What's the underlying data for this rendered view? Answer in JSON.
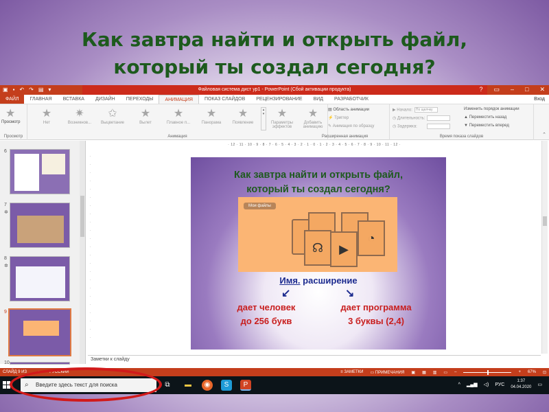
{
  "outer_title": {
    "line1": "Как завтра найти и открыть файл,",
    "line2": "который ты создал сегодня?"
  },
  "window": {
    "title": "Файловая система дист ур1 - PowerPoint (Сбой активации продукта)",
    "help": "?",
    "login": "Вход"
  },
  "tabs": [
    {
      "label": "ФАЙЛ"
    },
    {
      "label": "ГЛАВНАЯ"
    },
    {
      "label": "ВСТАВКА"
    },
    {
      "label": "ДИЗАЙН"
    },
    {
      "label": "ПЕРЕХОДЫ"
    },
    {
      "label": "АНИМАЦИЯ"
    },
    {
      "label": "ПОКАЗ СЛАЙДОВ"
    },
    {
      "label": "РЕЦЕНЗИРОВАНИЕ"
    },
    {
      "label": "ВИД"
    },
    {
      "label": "РАЗРАБОТЧИК"
    }
  ],
  "ribbon": {
    "preview": {
      "button": "Просмотр",
      "group": "Просмотр"
    },
    "animation": {
      "group": "Анимация",
      "effects": [
        "Нет",
        "Возникнов...",
        "Выцветание",
        "Вылет",
        "Плавное п...",
        "Панорама",
        "Появление"
      ],
      "options_button": "Параметры эффектов"
    },
    "advanced": {
      "group": "Расширенная анимация",
      "add_button": "Добавить анимацию",
      "pane": "Область анимации",
      "trigger": "Триггер",
      "painter": "Анимация по образцу"
    },
    "timing": {
      "group": "Время показа слайдов",
      "start_label": "Начало:",
      "start_value": "По щелчку",
      "duration_label": "Длительность:",
      "delay_label": "Задержка:",
      "reorder": "Изменить порядок анимации",
      "move_earlier": "Переместить назад",
      "move_later": "Переместить вперед"
    }
  },
  "thumbnails": [
    {
      "num": "6"
    },
    {
      "num": "7"
    },
    {
      "num": "8"
    },
    {
      "num": "9"
    },
    {
      "num": "10"
    }
  ],
  "ruler": "· 12 · 11 · 10 · 9 · 8 · 7 · 6 · 5 · 4 · 3 · 2 · 1 · 0 · 1 · 2 · 3 · 4 · 5 · 6 · 7 · 8 · 9 · 10 · 11 · 12 ·",
  "slide": {
    "title_line1": "Как завтра найти и открыть файл,",
    "title_line2": "который ты создал сегодня?",
    "folder_tag": "Мои файлы",
    "name_word": "Имя.",
    "ext_word": "расширение",
    "left_line1": "дает человек",
    "left_line2": "до 256 букв",
    "right_line1": "дает программа",
    "right_line2": "3 буквы (2,4)"
  },
  "notes_placeholder": "Заметки к слайду",
  "statusbar": {
    "slide": "СЛАЙД 9 ИЗ",
    "lang": "РУССКИЙ",
    "notes": "ЗАМЕТКИ",
    "comments": "ПРИМЕЧАНИЯ",
    "zoom": "67%"
  },
  "taskbar": {
    "search_placeholder": "Введите здесь текст для поиска",
    "lang": "РУС",
    "time": "1:37",
    "date": "04.04.2020"
  },
  "colors": {
    "accent": "#c43e1c",
    "title_green": "#1e5a1e",
    "slide_blue": "#1c2b8f",
    "slide_red": "#c81e1e",
    "highlight_ellipse": "#d11a1a"
  }
}
